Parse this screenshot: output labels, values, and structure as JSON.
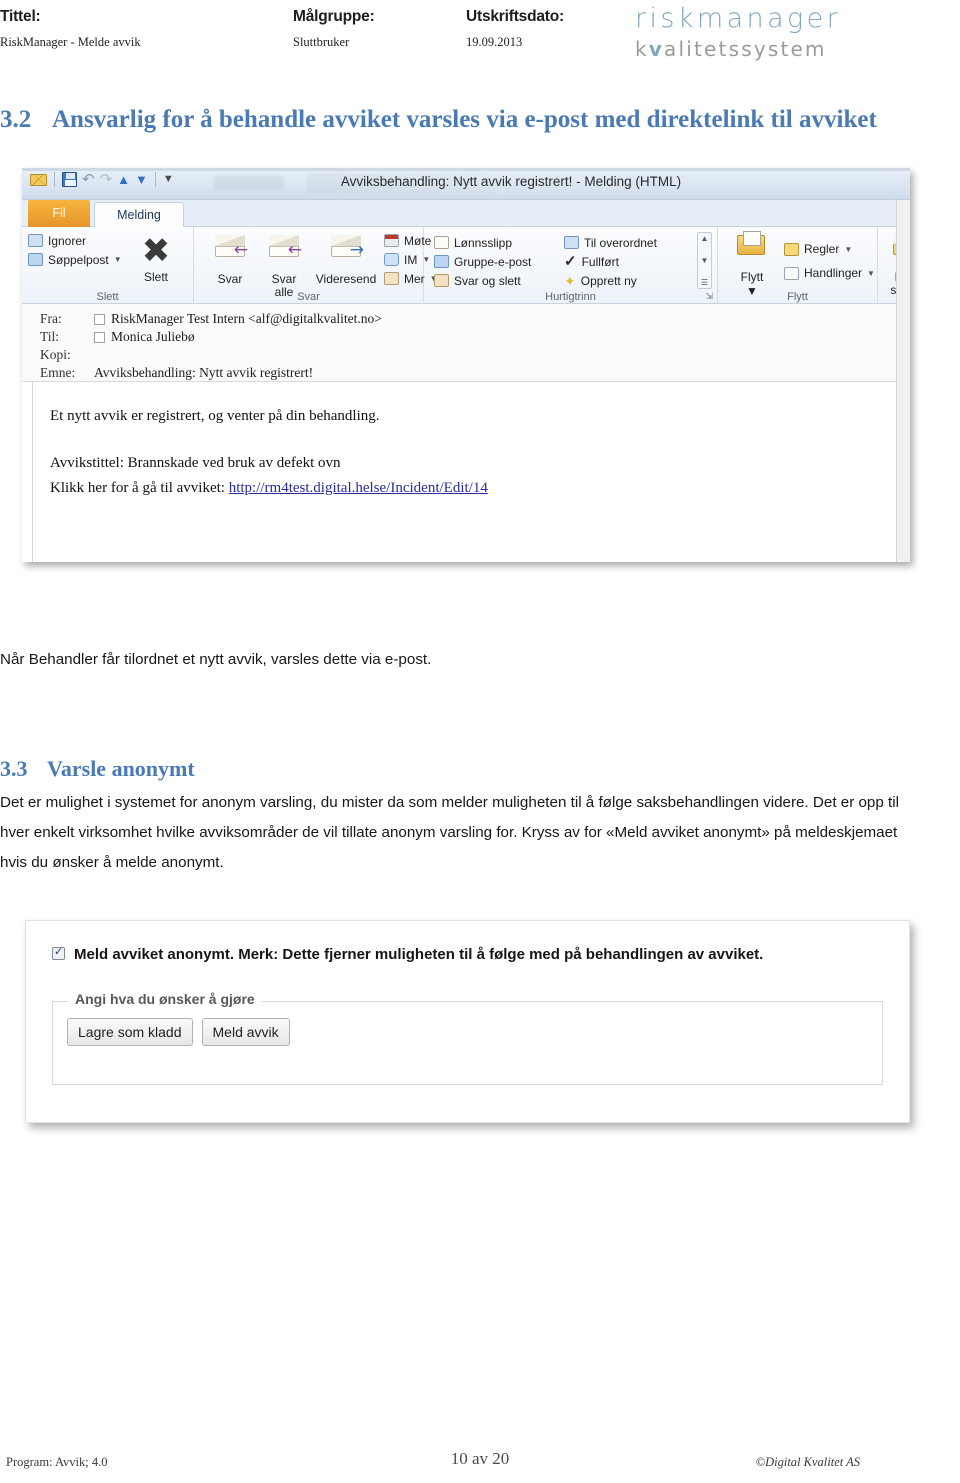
{
  "header": {
    "title_label": "Tittel:",
    "title_value": "RiskManager - Melde avvik",
    "audience_label": "Målgruppe:",
    "audience_value": "Sluttbruker",
    "printdate_label": "Utskriftsdato:",
    "printdate_value": "19.09.2013",
    "logo_top": "riskmanager",
    "logo_bottom_pre": "k",
    "logo_bottom_check": "v",
    "logo_bottom_post": "alitetssystem"
  },
  "sections": {
    "s32": {
      "number": "3.2",
      "title": "Ansvarlig for å behandle avviket varsles via e-post med direktelink til avviket"
    },
    "s33": {
      "number": "3.3",
      "title": "Varsle anonymt"
    }
  },
  "paragraphs": {
    "after_email": "Når Behandler får tilordnet et nytt avvik, varsles dette via e-post.",
    "anon": "Det er mulighet i systemet for anonym varsling, du mister da som melder muligheten til å følge saksbehandlingen videre. Det er opp til hver enkelt virksomhet hvilke avviksområder de vil tillate anonym varsling for. Kryss av for «Meld avviket anonymt» på meldeskjemaet hvis du ønsker å melde anonymt."
  },
  "outlook": {
    "window_title": "Avviksbehandling: Nytt avvik registrert!  -  Melding (HTML)",
    "quick_access": [
      "envelope-icon",
      "save-icon",
      "undo-icon",
      "redo-icon",
      "previous-item-icon",
      "next-item-icon",
      "customize-qat-icon"
    ],
    "tabs": [
      {
        "label": "Fil",
        "active": false
      },
      {
        "label": "Melding",
        "active": true
      }
    ],
    "groups": [
      {
        "name": "Slett",
        "label": "Slett",
        "items": [
          {
            "label": "Ignorer",
            "icon": "ignore-icon",
            "caret": false
          },
          {
            "label": "Søppelpost",
            "icon": "junk-icon",
            "caret": true
          }
        ],
        "big_button": {
          "label": "Slett",
          "icon": "delete-x-icon"
        }
      },
      {
        "name": "Svar",
        "label": "Svar",
        "big_buttons": [
          {
            "label": "Svar",
            "icon": "reply-icon"
          },
          {
            "label": "Svar\nalle",
            "icon": "reply-all-icon"
          },
          {
            "label": "Videresend",
            "icon": "forward-icon"
          }
        ],
        "items": [
          {
            "label": "Møte",
            "icon": "meeting-icon",
            "caret": false
          },
          {
            "label": "IM",
            "icon": "im-icon",
            "caret": true
          },
          {
            "label": "Mer",
            "icon": "more-icon",
            "caret": true
          }
        ]
      },
      {
        "name": "Hurtigtrinn",
        "label": "Hurtigtrinn",
        "col1": [
          {
            "label": "Lønnsslipp",
            "icon": "payslip-icon"
          },
          {
            "label": "Gruppe-e-post",
            "icon": "group-email-icon"
          },
          {
            "label": "Svar og slett",
            "icon": "reply-delete-icon"
          }
        ],
        "col2": [
          {
            "label": "Til overordnet",
            "icon": "to-manager-icon"
          },
          {
            "label": "Fullført",
            "icon": "done-check-icon"
          },
          {
            "label": "Opprett ny",
            "icon": "create-new-icon"
          }
        ]
      },
      {
        "name": "Flytt",
        "label": "Flytt",
        "big_button": {
          "label": "Flytt",
          "icon": "move-folder-icon",
          "caret": true
        },
        "items": [
          {
            "label": "Regler",
            "icon": "rules-icon",
            "caret": true
          },
          {
            "label": "Handlinger",
            "icon": "actions-icon",
            "caret": true
          }
        ]
      },
      {
        "name": "Merk",
        "label": "",
        "big_button": {
          "label_line1": "Merk",
          "label_line2": "som ul",
          "icon": "mark-unread-icon"
        }
      }
    ],
    "message": {
      "fields": [
        {
          "key": "Fra:",
          "value": "RiskManager Test Intern <alf@digitalkvalitet.no>",
          "has_checkbox": true
        },
        {
          "key": "Til:",
          "value": "Monica Juliebø",
          "has_checkbox": true
        },
        {
          "key": "Kopi:",
          "value": "",
          "has_checkbox": false
        },
        {
          "key": "Emne:",
          "value": "Avviksbehandling: Nytt avvik registrert!",
          "has_checkbox": false
        }
      ],
      "body_line1": "Et nytt avvik er registrert, og venter på din behandling.",
      "body_line2": "Avvikstittel: Brannskade ved bruk av defekt ovn",
      "body_line3_prefix": "Klikk her for å gå til avviket: ",
      "body_link": "http://rm4test.digital.helse/Incident/Edit/14"
    }
  },
  "anon_form": {
    "checkbox_checked": true,
    "checkbox_label": "Meld avviket anonymt. Merk: Dette fjerner muligheten til å følge med på behandlingen av avviket.",
    "fieldset_legend": "Angi hva du ønsker å gjøre",
    "buttons": [
      {
        "label": "Lagre som kladd"
      },
      {
        "label": "Meld avvik"
      }
    ]
  },
  "footer": {
    "left": "Program: Avvik; 4.0",
    "center": "10 av 20",
    "right": "©Digital Kvalitet AS"
  },
  "colors": {
    "heading_blue": "#4a7ab5",
    "logo_blue": "#7fa7bd",
    "link_blue": "#2b2b9e",
    "tab_orange": "#e8952a"
  }
}
